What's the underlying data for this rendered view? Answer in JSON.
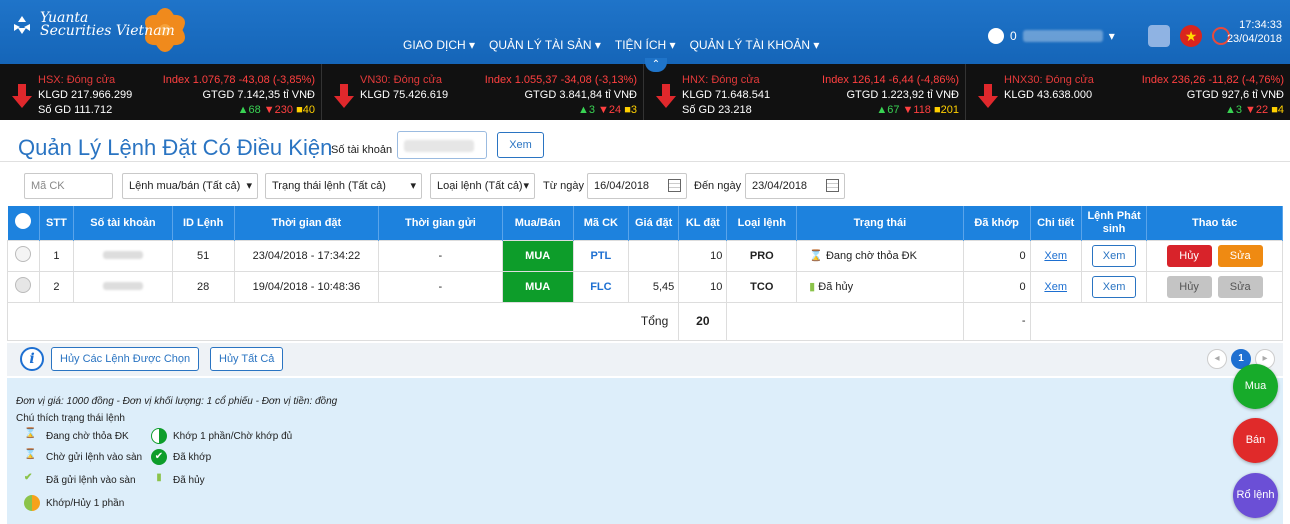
{
  "brand": {
    "name_line1": "Yuanta",
    "name_line2": "Securities Vietnam"
  },
  "nav": {
    "items": [
      "GIAO DỊCH ▾",
      "QUẢN LÝ TÀI SẢN ▾",
      "TIỆN ÍCH ▾",
      "QUẢN LÝ TÀI KHOẢN ▾"
    ]
  },
  "user": {
    "prefix": "0"
  },
  "clock": {
    "time": "17:34:33",
    "date": "23/04/2018"
  },
  "ticker": [
    {
      "name": "HSX: Đóng cửa",
      "klgd": "KLGD 217.966.299",
      "sogd": "Số GD 111.712",
      "index": "Index 1.076,78 -43,08 (-3,85%)",
      "gtgd": "GTGD 7.142,35 tỉ VNĐ",
      "up": "▲68",
      "down": "▼230",
      "flat": "■40"
    },
    {
      "name": "VN30: Đóng cửa",
      "klgd": "KLGD 75.426.619",
      "sogd": "",
      "index": "Index 1.055,37 -34,08 (-3,13%)",
      "gtgd": "GTGD 3.841,84 tỉ VNĐ",
      "up": "▲3",
      "down": "▼24",
      "flat": "■3"
    },
    {
      "name": "HNX: Đóng cửa",
      "klgd": "KLGD 71.648.541",
      "sogd": "Số GD 23.218",
      "index": "Index 126,14 -6,44 (-4,86%)",
      "gtgd": "GTGD 1.223,92 tỉ VNĐ",
      "up": "▲67",
      "down": "▼118",
      "flat": "■201"
    },
    {
      "name": "HNX30: Đóng cửa",
      "klgd": "KLGD 43.638.000",
      "sogd": "",
      "index": "Index 236,26 -11,82 (-4,76%)",
      "gtgd": "GTGD 927,6 tỉ VNĐ",
      "up": "▲3",
      "down": "▼22",
      "flat": "■4"
    }
  ],
  "page": {
    "title": "Quản Lý Lệnh Đặt Có Điều Kiện",
    "account_label": "Số tài khoản",
    "view_button": "Xem"
  },
  "filters": {
    "stock_code_placeholder": "Mã CK",
    "side": "Lệnh mua/bán (Tất cả)",
    "status": "Trạng thái lệnh (Tất cả)",
    "order_type": "Loại lệnh (Tất cả)",
    "from_label": "Từ ngày",
    "from_date": "16/04/2018",
    "to_label": "Đến ngày",
    "to_date": "23/04/2018"
  },
  "table": {
    "headers": [
      "STT",
      "Số tài khoản",
      "ID Lệnh",
      "Thời gian đặt",
      "Thời gian gửi",
      "Mua/Bán",
      "Mã CK",
      "Giá đặt",
      "KL đặt",
      "Loại lệnh",
      "Trạng thái",
      "Đã khớp",
      "Chi tiết",
      "Lệnh Phát sinh",
      "Thao tác"
    ],
    "rows": [
      {
        "stt": "1",
        "id": "51",
        "time": "23/04/2018 - 17:34:22",
        "sent": "-",
        "side": "MUA",
        "code": "PTL",
        "price": "",
        "qty": "10",
        "type": "PRO",
        "status": "Đang chờ thỏa ĐK",
        "matched": "0",
        "detail": "Xem",
        "gen": "Xem",
        "cancel": "Hủy",
        "edit": "Sửa"
      },
      {
        "stt": "2",
        "id": "28",
        "time": "19/04/2018 - 10:48:36",
        "sent": "-",
        "side": "MUA",
        "code": "FLC",
        "price": "5,45",
        "qty": "10",
        "type": "TCO",
        "status": "Đã hủy",
        "matched": "0",
        "detail": "Xem",
        "gen": "Xem",
        "cancel": "Hủy",
        "edit": "Sửa"
      }
    ],
    "total_label": "Tổng",
    "total_qty": "20",
    "total_matched": "-"
  },
  "actions": {
    "cancel_selected": "Hủy Các Lệnh Được Chọn",
    "cancel_all": "Hủy Tất Cả",
    "page": "1"
  },
  "legend": {
    "units": "Đơn vị giá: 1000 đồng - Đơn vị khối lượng: 1 cổ phiếu - Đơn vị tiền: đồng",
    "title": "Chú thích trạng thái lệnh",
    "items": [
      "Đang chờ thỏa ĐK",
      "Chờ gửi lệnh vào sàn",
      "Đã gửi lệnh vào sàn",
      "Khớp/Hủy 1 phần",
      "Khớp 1 phần/Chờ khớp đủ",
      "Đã khớp",
      "Đã hủy"
    ]
  },
  "fabs": {
    "buy": "Mua",
    "sell": "Bán",
    "basket": "Rổ lệnh"
  },
  "colors": {
    "header_blue": "#1d82de",
    "buy_green": "#0d9d2a",
    "cancel_red": "#d8232a",
    "edit_orange": "#ef8a12"
  }
}
